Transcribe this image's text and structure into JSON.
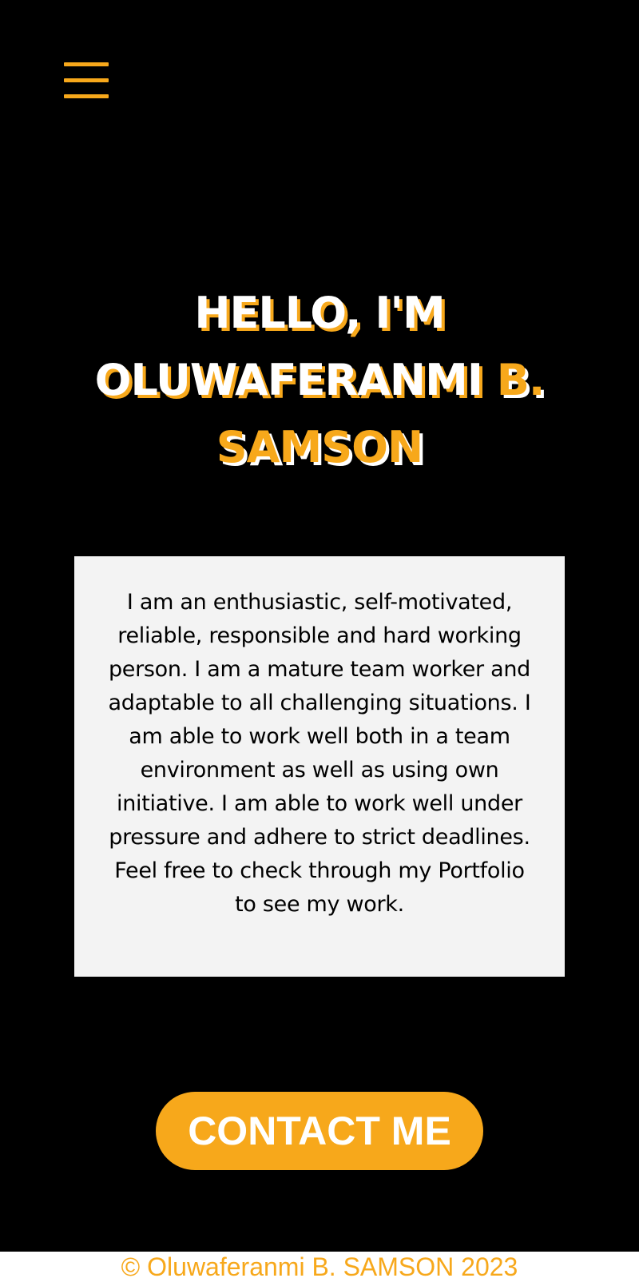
{
  "nav": {
    "menu_icon": "hamburger-menu-icon"
  },
  "hero": {
    "line1": "HELLO, I'M",
    "name_part1": "OLUWAFERANMI",
    "name_part2": "B.",
    "name_part3": "SAMSON"
  },
  "about": {
    "text": "I am an enthusiastic, self-motivated, reliable, responsible and hard working person. I am a mature team worker and adaptable to all challenging situations. I am able to work well both in a team environment as well as using own initiative. I am able to work well under pressure and adhere to strict deadlines. Feel free to check through my Portfolio to see my work."
  },
  "contact": {
    "label": "CONTACT ME"
  },
  "footer": {
    "text": "© Oluwaferanmi B. SAMSON 2023"
  },
  "colors": {
    "background": "#000000",
    "accent": "#f7a81b",
    "card": "#f3f3f3",
    "text_light": "#ffffff"
  }
}
